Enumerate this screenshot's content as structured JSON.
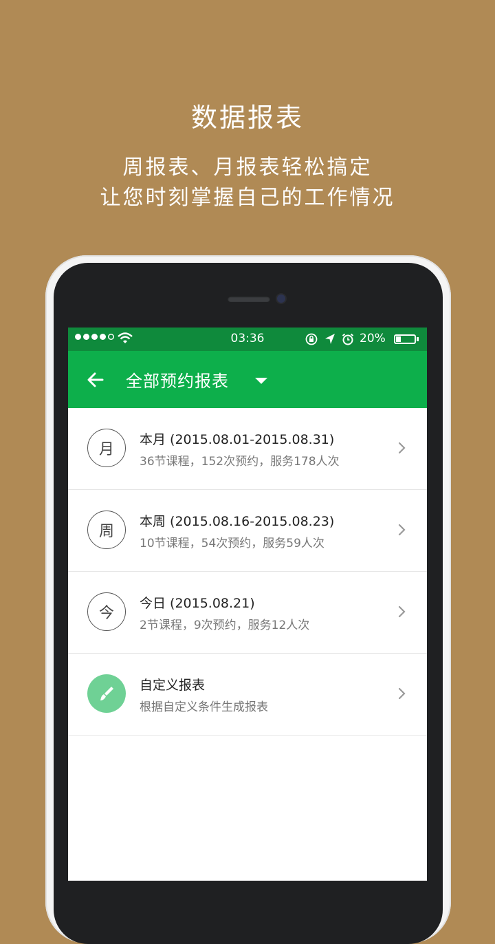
{
  "promo": {
    "title": "数据报表",
    "subtitle_line1": "周报表、月报表轻松搞定",
    "subtitle_line2": "让您时刻掌握自己的工作情况"
  },
  "status_bar": {
    "time": "03:36",
    "battery": "20%",
    "battery_level": 0.2,
    "signal_dots": 4,
    "icons": [
      "orientation-lock-icon",
      "location-arrow-icon",
      "alarm-icon",
      "battery-icon",
      "wifi-icon"
    ]
  },
  "app_bar": {
    "title": "全部预约报表",
    "back_icon": "arrow-left-icon",
    "dropdown_icon": "caret-down-icon"
  },
  "colors": {
    "background": "#b08a55",
    "status_bar": "#0f8a3c",
    "app_bar": "#0daf4b",
    "custom_badge": "#6fd195"
  },
  "reports": [
    {
      "badge": "月",
      "title": "本月 (2015.08.01-2015.08.31)",
      "summary": "36节课程，152次预约，服务178人次"
    },
    {
      "badge": "周",
      "title": "本周 (2015.08.16-2015.08.23)",
      "summary": "10节课程，54次预约，服务59人次"
    },
    {
      "badge": "今",
      "title": "今日 (2015.08.21)",
      "summary": "2节课程，9次预约，服务12人次"
    },
    {
      "badge_icon": "brush-icon",
      "title": "自定义报表",
      "summary": "根据自定义条件生成报表"
    }
  ]
}
